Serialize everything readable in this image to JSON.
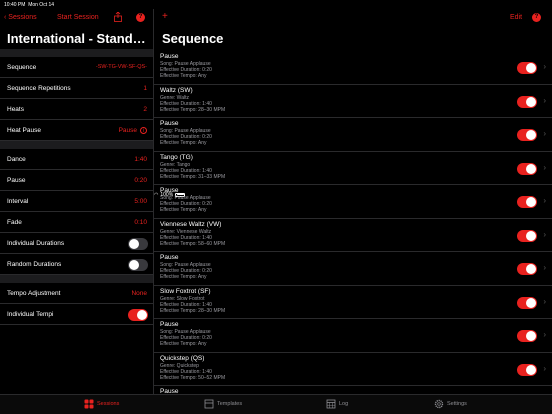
{
  "status": {
    "time": "10:40 PM",
    "date": "Mon Oct 14",
    "battery": "100%"
  },
  "left": {
    "back_label": "Sessions",
    "start_label": "Start Session",
    "title": "International - Stand…",
    "rows1": [
      {
        "label": "Sequence",
        "value": "-SW-TG-VW-SF-QS-"
      },
      {
        "label": "Sequence Repetitions",
        "value": "1"
      },
      {
        "label": "Heats",
        "value": "2"
      },
      {
        "label": "Heat Pause",
        "value": "Pause"
      }
    ],
    "rows2": [
      {
        "label": "Dance",
        "value": "1:40"
      },
      {
        "label": "Pause",
        "value": "0:20"
      },
      {
        "label": "Interval",
        "value": "5:00"
      },
      {
        "label": "Fade",
        "value": "0:10"
      }
    ],
    "individual_durations": {
      "label": "Individual Durations",
      "on": false
    },
    "random_durations": {
      "label": "Random Durations",
      "on": false
    },
    "tempo_adjustment": {
      "label": "Tempo Adjustment",
      "value": "None"
    },
    "individual_tempi": {
      "label": "Individual Tempi",
      "on": true
    }
  },
  "right": {
    "edit_label": "Edit",
    "title": "Sequence",
    "items": [
      {
        "name": "Pause",
        "l1": "Song: Pause Applause",
        "l2": "Effective Duration: 0:20",
        "l3": "Effective Tempo: Any"
      },
      {
        "name": "Waltz (SW)",
        "l1": "Genre: Waltz",
        "l2": "Effective Duration: 1:40",
        "l3": "Effective Tempo: 28–30 MPM"
      },
      {
        "name": "Pause",
        "l1": "Song: Pause Applause",
        "l2": "Effective Duration: 0:20",
        "l3": "Effective Tempo: Any"
      },
      {
        "name": "Tango (TG)",
        "l1": "Genre: Tango",
        "l2": "Effective Duration: 1:40",
        "l3": "Effective Tempo: 31–33 MPM"
      },
      {
        "name": "Pause",
        "l1": "Song: Pause Applause",
        "l2": "Effective Duration: 0:20",
        "l3": "Effective Tempo: Any"
      },
      {
        "name": "Viennese Waltz (VW)",
        "l1": "Genre: Viennese Waltz",
        "l2": "Effective Duration: 1:40",
        "l3": "Effective Tempo: 58–60 MPM"
      },
      {
        "name": "Pause",
        "l1": "Song: Pause Applause",
        "l2": "Effective Duration: 0:20",
        "l3": "Effective Tempo: Any"
      },
      {
        "name": "Slow Foxtrot (SF)",
        "l1": "Genre: Slow Foxtrot",
        "l2": "Effective Duration: 1:40",
        "l3": "Effective Tempo: 28–30 MPM"
      },
      {
        "name": "Pause",
        "l1": "Song: Pause Applause",
        "l2": "Effective Duration: 0:20",
        "l3": "Effective Tempo: Any"
      },
      {
        "name": "Quickstep (QS)",
        "l1": "Genre: Quickstep",
        "l2": "Effective Duration: 1:40",
        "l3": "Effective Tempo: 50–52 MPM"
      },
      {
        "name": "Pause",
        "l1": "",
        "l2": "",
        "l3": ""
      }
    ]
  },
  "tabs": [
    {
      "label": "Sessions",
      "icon": "sessions-icon",
      "active": true
    },
    {
      "label": "Templates",
      "icon": "templates-icon",
      "active": false
    },
    {
      "label": "Log",
      "icon": "log-icon",
      "active": false
    },
    {
      "label": "Settings",
      "icon": "settings-icon",
      "active": false
    }
  ],
  "colors": {
    "accent": "#e8221f",
    "background": "#000000",
    "separator": "#1c1c1e"
  }
}
